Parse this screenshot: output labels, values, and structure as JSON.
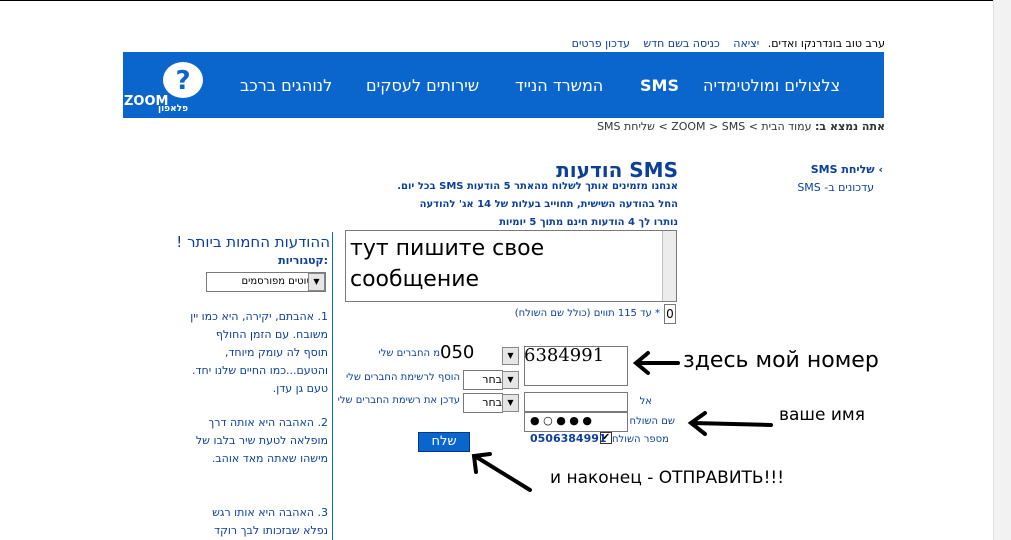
{
  "header": {
    "greeting_name": "ערב טוב בונדרנקו ואדים.",
    "logout": "יציאה",
    "login_other": "כניסה בשם חדש",
    "update_details": "עדכון פרטים"
  },
  "nav": {
    "items": [
      "צלצולים ומולטימדיה",
      "SMS",
      "המשרד הנייד",
      "שירותים לעסקים",
      "לנוהגים ברכב"
    ],
    "logo_text": "ZOOM",
    "logo_sub": "פלאפון"
  },
  "breadcrumb": {
    "prefix": "אתה נמצא ב:",
    "path": "עמוד הבית > ZOOM > SMS > שליחת SMS"
  },
  "sidebar": {
    "link1": "› שליחת SMS",
    "link2": "עדכונים ב- SMS"
  },
  "main": {
    "title": "הודעות SMS",
    "info1": "אנחנו מזמינים אותך לשלוח מהאתר 5 הודעות SMS בכל יום.",
    "info2": "החל בהודעה השישית, תחוייב בעלות של 14 אג' להודעה",
    "info3": "נותרו לך 4 הודעות חינם מתוך 5 יומיות",
    "message_text": "тут пишите свое сообщение",
    "counter": "0",
    "char_limit": "* עד 115 תווים (כולל שם השולח)",
    "prefix_value": "050",
    "number_value": "6384991",
    "label_friends": "מ החברים שלי",
    "label_add": "הוסף לרשימת החברים שלי",
    "label_update": "עדכן את רשימת החברים שלי",
    "label_to": "אל",
    "label_sender": "שם השולח",
    "label_sender_number": "מספר השולח",
    "select_choose": "בחר",
    "sender_name_value": "● ○ ● ● ●",
    "sender_number_value": "0506384991",
    "send_button": "שלח"
  },
  "annotations": {
    "number": "здесь мой номер",
    "name": "ваше имя",
    "send": "и наконец - ОТПРАВИТЬ!!!"
  },
  "hot_panel": {
    "title": "ההודעות החמות ביותר !",
    "categories_label": "קטגוריות:",
    "category_value": "ציטוטים מפורסמים",
    "quote1": "1. אהבתם, יקירה, היא כמו יין משובח. עם הזמן החולף תוסף לה עומק מיוחד, והטעם...כמו החיים שלנו יחד. טעם גן עדן.",
    "quote2": "2. האהבה היא אותה דרך מופלאה לטעת שיר בלבו של מישהו שאתה מאד אוהב.",
    "quote3": "3. האהבה היא אותו רגש נפלא שבזכותו לבך רוקד"
  },
  "colors": {
    "brand_blue": "#0a66cc",
    "link_blue": "#0b3f9c"
  }
}
